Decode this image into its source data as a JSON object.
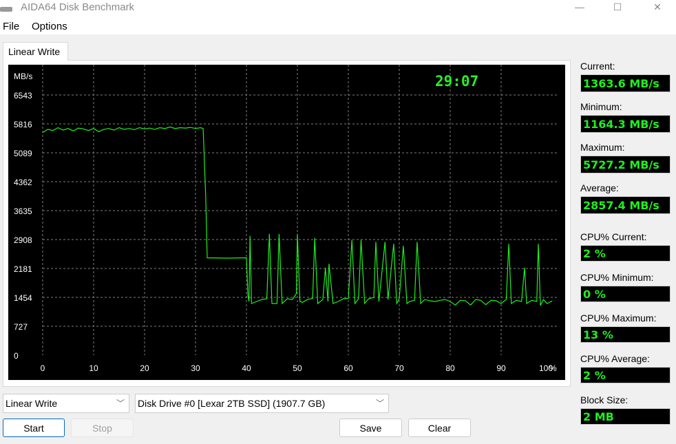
{
  "window": {
    "title": "AIDA64 Disk Benchmark",
    "minimize": "—",
    "maximize": "☐",
    "close": "✕"
  },
  "menu": [
    "File",
    "Options"
  ],
  "tab": "Linear Write",
  "timer": "29:07",
  "stats": [
    {
      "label": "Current:",
      "value": "1363.6 MB/s"
    },
    {
      "label": "Minimum:",
      "value": "1164.3 MB/s"
    },
    {
      "label": "Maximum:",
      "value": "5727.2 MB/s"
    },
    {
      "label": "Average:",
      "value": "2857.4 MB/s"
    },
    {
      "label": "CPU% Current:",
      "value": "2 %"
    },
    {
      "label": "CPU% Minimum:",
      "value": "0 %"
    },
    {
      "label": "CPU% Maximum:",
      "value": "13 %"
    },
    {
      "label": "CPU% Average:",
      "value": "2 %"
    },
    {
      "label": "Block Size:",
      "value": "2 MB"
    }
  ],
  "controls": {
    "test_select": "Linear Write",
    "drive_select": "Disk Drive #0  [Lexar 2TB SSD]  (1907.7 GB)",
    "start": "Start",
    "stop": "Stop",
    "save": "Save",
    "clear": "Clear"
  },
  "colors": {
    "line": "#1ef01e",
    "background": "#000000",
    "grid": "#808080"
  },
  "chart_data": {
    "type": "line",
    "ylabel": "MB/s",
    "xlabel": "%",
    "xlim": [
      0,
      100
    ],
    "ylim": [
      0,
      6543
    ],
    "grid": true,
    "yticks": [
      0,
      727,
      1454,
      2181,
      2908,
      3635,
      4362,
      5089,
      5816,
      6543
    ],
    "xticks": [
      0,
      10,
      20,
      30,
      40,
      50,
      60,
      70,
      80,
      90,
      100
    ],
    "x": [
      0,
      1,
      2,
      3,
      4,
      5,
      6,
      7,
      8,
      9,
      10,
      11,
      12,
      13,
      14,
      15,
      16,
      17,
      18,
      19,
      20,
      21,
      22,
      23,
      24,
      25,
      26,
      27,
      28,
      29,
      30,
      31,
      31.5,
      32,
      32.3,
      36,
      40,
      40.3,
      40.5,
      40.7,
      41,
      42,
      43,
      44,
      44.5,
      45,
      46,
      46.4,
      47,
      48,
      49,
      49.8,
      50,
      50.5,
      51,
      52,
      53,
      53.4,
      54,
      55,
      55.5,
      56,
      56.2,
      57,
      58,
      59,
      60,
      60.7,
      61.3,
      62,
      62.5,
      63.2,
      64,
      65,
      65.4,
      66,
      67.2,
      67.8,
      68.9,
      69.5,
      70,
      70.8,
      71.5,
      72,
      73,
      73.5,
      74.2,
      75,
      76,
      77,
      78,
      79,
      80,
      81,
      82,
      83,
      84,
      85,
      86,
      87,
      88,
      89,
      90,
      91,
      91.5,
      92,
      93,
      94,
      94.6,
      95,
      96,
      97,
      97.3,
      97.7,
      98.3,
      99,
      100
    ],
    "y": [
      5600,
      5680,
      5650,
      5720,
      5660,
      5700,
      5640,
      5710,
      5690,
      5650,
      5700,
      5620,
      5680,
      5700,
      5660,
      5720,
      5680,
      5700,
      5670,
      5720,
      5690,
      5710,
      5680,
      5720,
      5700,
      5740,
      5700,
      5720,
      5710,
      5727,
      5700,
      5720,
      5700,
      4000,
      2450,
      2440,
      2450,
      1500,
      1350,
      3000,
      1300,
      1350,
      1400,
      1420,
      3050,
      1300,
      1300,
      3050,
      1300,
      1420,
      1400,
      1550,
      3050,
      1350,
      1330,
      1400,
      1430,
      2950,
      1300,
      1400,
      2200,
      1350,
      2300,
      1300,
      1350,
      1420,
      1430,
      2900,
      1300,
      1420,
      2900,
      1300,
      1420,
      1450,
      2850,
      1350,
      2850,
      1400,
      2800,
      1300,
      1420,
      2750,
      1300,
      1350,
      1380,
      2850,
      1300,
      1400,
      1370,
      1350,
      1380,
      1400,
      1350,
      1260,
      1380,
      1370,
      1260,
      1400,
      1380,
      1270,
      1380,
      1370,
      1300,
      1400,
      2800,
      1300,
      1380,
      1350,
      2200,
      1300,
      1380,
      1350,
      2800,
      1250,
      1400,
      1300,
      1363
    ]
  }
}
